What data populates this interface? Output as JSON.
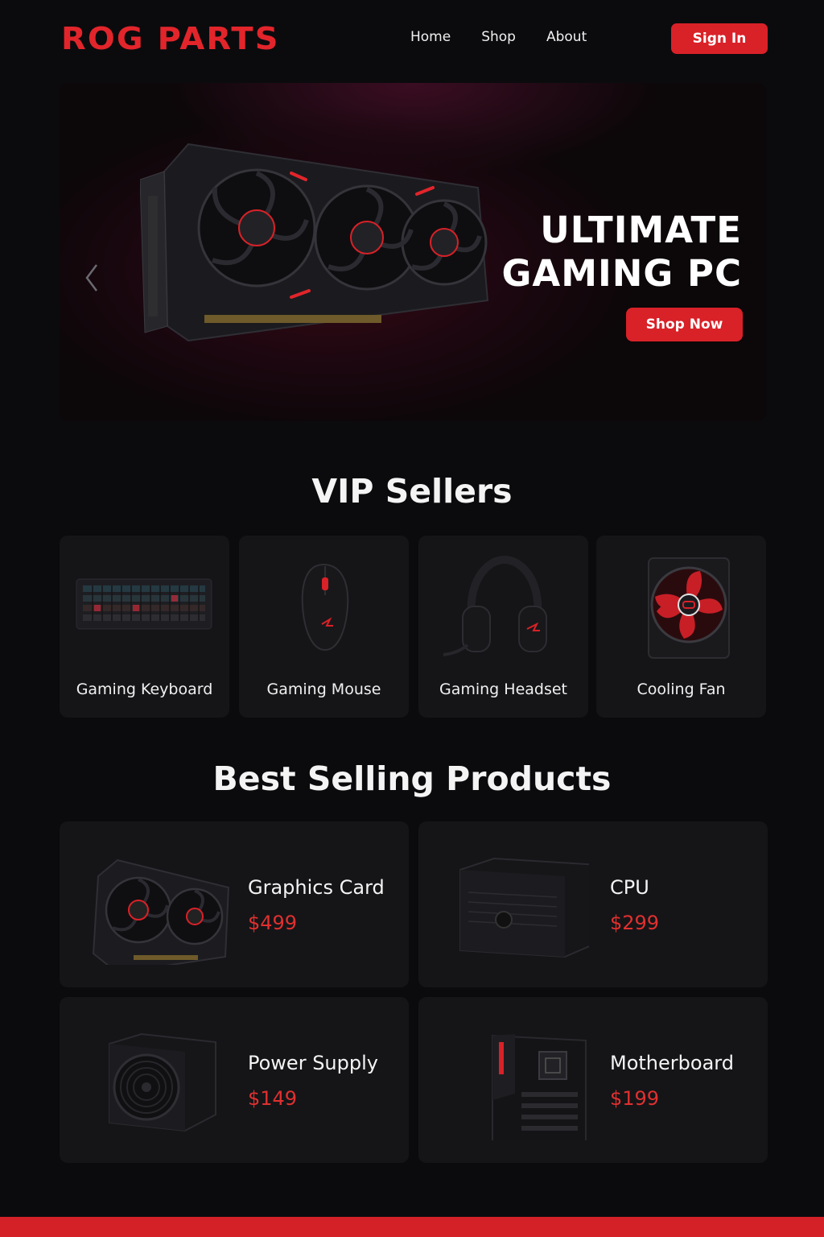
{
  "brand": {
    "logo": "ROG PARTS",
    "accent": "#d92128"
  },
  "nav": {
    "items": [
      "Home",
      "Shop",
      "About"
    ],
    "signin": "Sign In"
  },
  "hero": {
    "title_line1": "ULTIMATE",
    "title_line2": "GAMING PC",
    "cta": "Shop Now",
    "prev_icon": "chevron-left-icon"
  },
  "vip": {
    "title": "VIP Sellers",
    "items": [
      {
        "label": "Gaming Keyboard",
        "icon": "keyboard-icon"
      },
      {
        "label": "Gaming Mouse",
        "icon": "mouse-icon"
      },
      {
        "label": "Gaming Headset",
        "icon": "headset-icon"
      },
      {
        "label": "Cooling Fan",
        "icon": "fan-icon"
      }
    ]
  },
  "best": {
    "title": "Best Selling Products",
    "items": [
      {
        "name": "Graphics Card",
        "price": "$499",
        "icon": "graphics-card-icon"
      },
      {
        "name": "CPU",
        "price": "$299",
        "icon": "cpu-icon"
      },
      {
        "name": "Power Supply",
        "price": "$149",
        "icon": "power-supply-icon"
      },
      {
        "name": "Motherboard",
        "price": "$199",
        "icon": "motherboard-icon"
      }
    ]
  }
}
